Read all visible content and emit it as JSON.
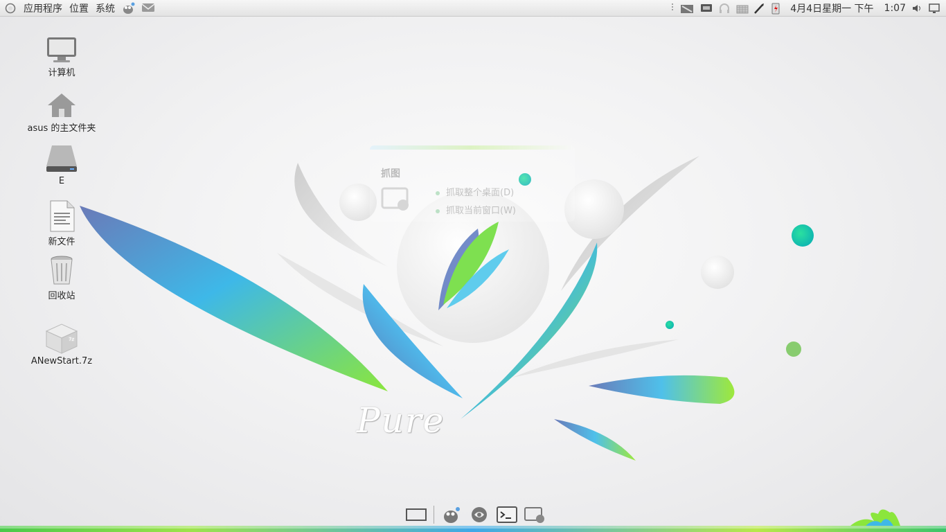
{
  "topbar": {
    "menus": [
      "应用程序",
      "位置",
      "系统"
    ],
    "datetime": "4月4日星期一 下午",
    "time": "1:07",
    "icons": [
      "ubuntu-logo-icon",
      "gimp-icon",
      "mail-icon",
      "grip-icon",
      "network-icon",
      "display-icon",
      "headphones-icon",
      "keyboard-icon",
      "pen-icon",
      "battery-icon",
      "volume-icon",
      "monitor-icon"
    ]
  },
  "desktop": {
    "icons": [
      {
        "label": "计算机",
        "icon": "computer-icon"
      },
      {
        "label": "asus 的主文件夹",
        "icon": "home-folder-icon"
      },
      {
        "label": "E",
        "icon": "drive-icon"
      },
      {
        "label": "新文件",
        "icon": "document-icon"
      },
      {
        "label": "回收站",
        "icon": "trash-icon"
      },
      {
        "label": "ANewStart.7z",
        "icon": "archive-icon"
      }
    ]
  },
  "screenshot_dialog": {
    "title": "抓图",
    "option_desktop": "抓取整个桌面(D)",
    "option_window": "抓取当前窗口(W)"
  },
  "wallpaper": {
    "brand": "Pure",
    "colors": {
      "blue": "#4f8fe0",
      "green": "#8be63c",
      "teal": "#22c8a0",
      "grey": "#cfcfcf"
    }
  },
  "dock": {
    "items": [
      "show-desktop-icon",
      "gimp-icon",
      "settings-icon",
      "terminal-icon",
      "screenshot-icon"
    ]
  }
}
